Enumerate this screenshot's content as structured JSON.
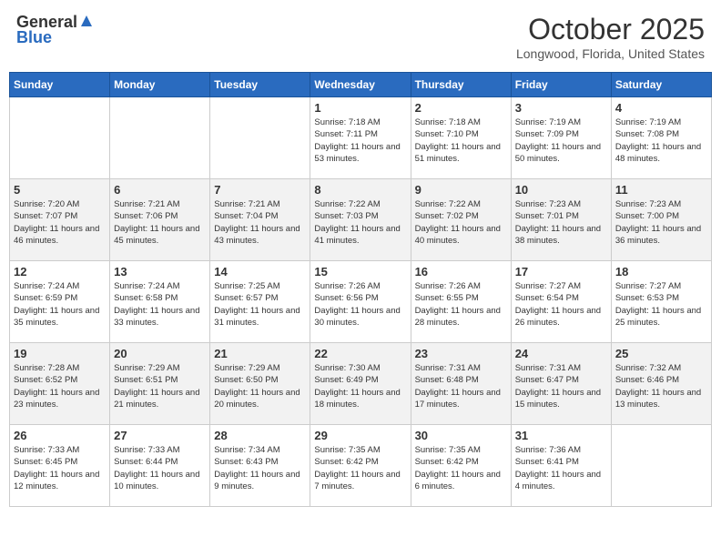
{
  "header": {
    "logo_general": "General",
    "logo_blue": "Blue",
    "month_title": "October 2025",
    "location": "Longwood, Florida, United States"
  },
  "days_of_week": [
    "Sunday",
    "Monday",
    "Tuesday",
    "Wednesday",
    "Thursday",
    "Friday",
    "Saturday"
  ],
  "weeks": [
    [
      {
        "day": "",
        "content": ""
      },
      {
        "day": "",
        "content": ""
      },
      {
        "day": "",
        "content": ""
      },
      {
        "day": "1",
        "content": "Sunrise: 7:18 AM\nSunset: 7:11 PM\nDaylight: 11 hours and 53 minutes."
      },
      {
        "day": "2",
        "content": "Sunrise: 7:18 AM\nSunset: 7:10 PM\nDaylight: 11 hours and 51 minutes."
      },
      {
        "day": "3",
        "content": "Sunrise: 7:19 AM\nSunset: 7:09 PM\nDaylight: 11 hours and 50 minutes."
      },
      {
        "day": "4",
        "content": "Sunrise: 7:19 AM\nSunset: 7:08 PM\nDaylight: 11 hours and 48 minutes."
      }
    ],
    [
      {
        "day": "5",
        "content": "Sunrise: 7:20 AM\nSunset: 7:07 PM\nDaylight: 11 hours and 46 minutes."
      },
      {
        "day": "6",
        "content": "Sunrise: 7:21 AM\nSunset: 7:06 PM\nDaylight: 11 hours and 45 minutes."
      },
      {
        "day": "7",
        "content": "Sunrise: 7:21 AM\nSunset: 7:04 PM\nDaylight: 11 hours and 43 minutes."
      },
      {
        "day": "8",
        "content": "Sunrise: 7:22 AM\nSunset: 7:03 PM\nDaylight: 11 hours and 41 minutes."
      },
      {
        "day": "9",
        "content": "Sunrise: 7:22 AM\nSunset: 7:02 PM\nDaylight: 11 hours and 40 minutes."
      },
      {
        "day": "10",
        "content": "Sunrise: 7:23 AM\nSunset: 7:01 PM\nDaylight: 11 hours and 38 minutes."
      },
      {
        "day": "11",
        "content": "Sunrise: 7:23 AM\nSunset: 7:00 PM\nDaylight: 11 hours and 36 minutes."
      }
    ],
    [
      {
        "day": "12",
        "content": "Sunrise: 7:24 AM\nSunset: 6:59 PM\nDaylight: 11 hours and 35 minutes."
      },
      {
        "day": "13",
        "content": "Sunrise: 7:24 AM\nSunset: 6:58 PM\nDaylight: 11 hours and 33 minutes."
      },
      {
        "day": "14",
        "content": "Sunrise: 7:25 AM\nSunset: 6:57 PM\nDaylight: 11 hours and 31 minutes."
      },
      {
        "day": "15",
        "content": "Sunrise: 7:26 AM\nSunset: 6:56 PM\nDaylight: 11 hours and 30 minutes."
      },
      {
        "day": "16",
        "content": "Sunrise: 7:26 AM\nSunset: 6:55 PM\nDaylight: 11 hours and 28 minutes."
      },
      {
        "day": "17",
        "content": "Sunrise: 7:27 AM\nSunset: 6:54 PM\nDaylight: 11 hours and 26 minutes."
      },
      {
        "day": "18",
        "content": "Sunrise: 7:27 AM\nSunset: 6:53 PM\nDaylight: 11 hours and 25 minutes."
      }
    ],
    [
      {
        "day": "19",
        "content": "Sunrise: 7:28 AM\nSunset: 6:52 PM\nDaylight: 11 hours and 23 minutes."
      },
      {
        "day": "20",
        "content": "Sunrise: 7:29 AM\nSunset: 6:51 PM\nDaylight: 11 hours and 21 minutes."
      },
      {
        "day": "21",
        "content": "Sunrise: 7:29 AM\nSunset: 6:50 PM\nDaylight: 11 hours and 20 minutes."
      },
      {
        "day": "22",
        "content": "Sunrise: 7:30 AM\nSunset: 6:49 PM\nDaylight: 11 hours and 18 minutes."
      },
      {
        "day": "23",
        "content": "Sunrise: 7:31 AM\nSunset: 6:48 PM\nDaylight: 11 hours and 17 minutes."
      },
      {
        "day": "24",
        "content": "Sunrise: 7:31 AM\nSunset: 6:47 PM\nDaylight: 11 hours and 15 minutes."
      },
      {
        "day": "25",
        "content": "Sunrise: 7:32 AM\nSunset: 6:46 PM\nDaylight: 11 hours and 13 minutes."
      }
    ],
    [
      {
        "day": "26",
        "content": "Sunrise: 7:33 AM\nSunset: 6:45 PM\nDaylight: 11 hours and 12 minutes."
      },
      {
        "day": "27",
        "content": "Sunrise: 7:33 AM\nSunset: 6:44 PM\nDaylight: 11 hours and 10 minutes."
      },
      {
        "day": "28",
        "content": "Sunrise: 7:34 AM\nSunset: 6:43 PM\nDaylight: 11 hours and 9 minutes."
      },
      {
        "day": "29",
        "content": "Sunrise: 7:35 AM\nSunset: 6:42 PM\nDaylight: 11 hours and 7 minutes."
      },
      {
        "day": "30",
        "content": "Sunrise: 7:35 AM\nSunset: 6:42 PM\nDaylight: 11 hours and 6 minutes."
      },
      {
        "day": "31",
        "content": "Sunrise: 7:36 AM\nSunset: 6:41 PM\nDaylight: 11 hours and 4 minutes."
      },
      {
        "day": "",
        "content": ""
      }
    ]
  ]
}
